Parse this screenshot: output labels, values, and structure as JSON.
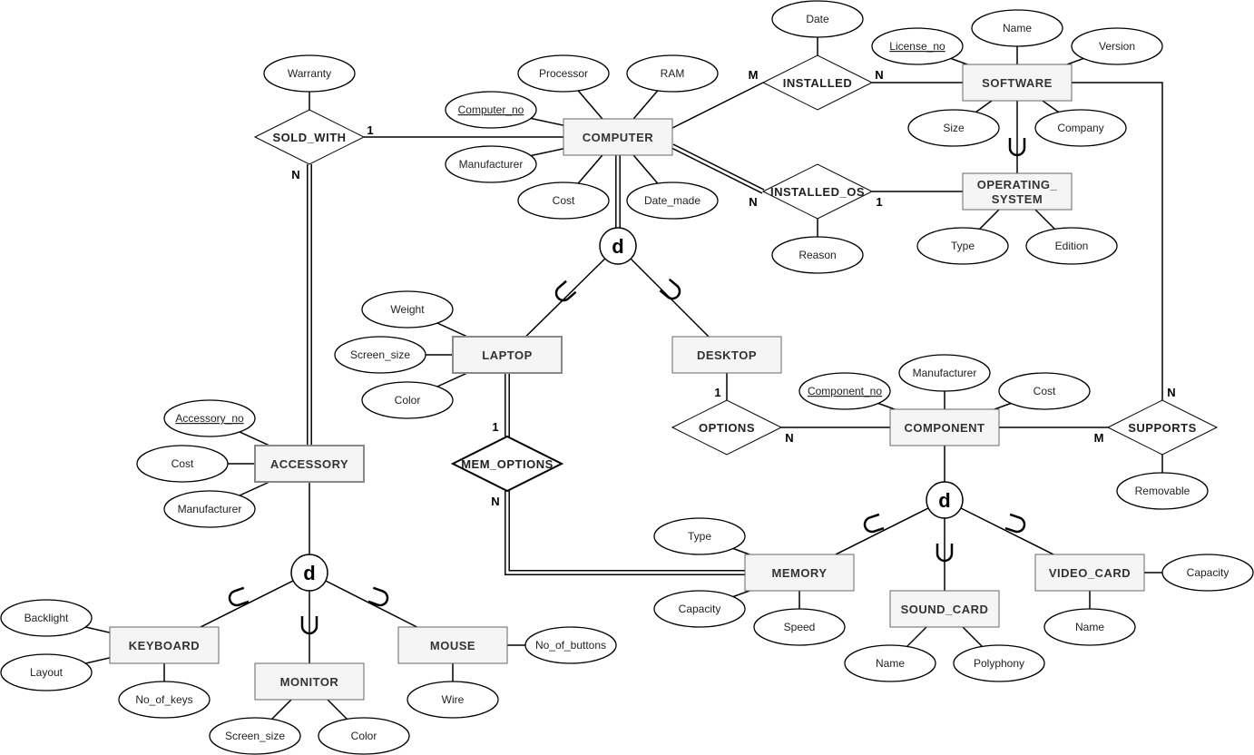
{
  "entities": [
    {
      "label": "COMPUTER"
    },
    {
      "label": "SOFTWARE"
    },
    {
      "label": "OPERATING_ SYSTEM"
    },
    {
      "label": "LAPTOP"
    },
    {
      "label": "DESKTOP"
    },
    {
      "label": "COMPONENT"
    },
    {
      "label": "ACCESSORY"
    },
    {
      "label": "MEMORY"
    },
    {
      "label": "SOUND_CARD"
    },
    {
      "label": "VIDEO_CARD"
    },
    {
      "label": "KEYBOARD"
    },
    {
      "label": "MONITOR"
    },
    {
      "label": "MOUSE"
    }
  ],
  "relationships": [
    {
      "label": "SOLD_WITH"
    },
    {
      "label": "INSTALLED"
    },
    {
      "label": "INSTALLED_OS"
    },
    {
      "label": "OPTIONS"
    },
    {
      "label": "MEM_OPTIONS"
    },
    {
      "label": "SUPPORTS"
    }
  ],
  "attributes": [
    {
      "label": "Warranty",
      "key": false
    },
    {
      "label": "Processor",
      "key": false
    },
    {
      "label": "RAM",
      "key": false
    },
    {
      "label": "Computer_no",
      "key": true
    },
    {
      "label": "Manufacturer",
      "key": false
    },
    {
      "label": "Cost",
      "key": false
    },
    {
      "label": "Date_made",
      "key": false
    },
    {
      "label": "Date",
      "key": false
    },
    {
      "label": "License_no",
      "key": true
    },
    {
      "label": "Name",
      "key": false
    },
    {
      "label": "Version",
      "key": false
    },
    {
      "label": "Size",
      "key": false
    },
    {
      "label": "Company",
      "key": false
    },
    {
      "label": "Type",
      "key": false
    },
    {
      "label": "Edition",
      "key": false
    },
    {
      "label": "Reason",
      "key": false
    },
    {
      "label": "Weight",
      "key": false
    },
    {
      "label": "Screen_size",
      "key": false
    },
    {
      "label": "Color",
      "key": false
    },
    {
      "label": "Accessory_no",
      "key": true
    },
    {
      "label": "Cost",
      "key": false
    },
    {
      "label": "Manufacturer",
      "key": false
    },
    {
      "label": "Manufacturer",
      "key": false
    },
    {
      "label": "Component_no",
      "key": true
    },
    {
      "label": "Cost",
      "key": false
    },
    {
      "label": "Removable",
      "key": false
    },
    {
      "label": "Type",
      "key": false
    },
    {
      "label": "Capacity",
      "key": false
    },
    {
      "label": "Speed",
      "key": false
    },
    {
      "label": "Name",
      "key": false
    },
    {
      "label": "Polyphony",
      "key": false
    },
    {
      "label": "Capacity",
      "key": false
    },
    {
      "label": "Name",
      "key": false
    },
    {
      "label": "Backlight",
      "key": false
    },
    {
      "label": "Layout",
      "key": false
    },
    {
      "label": "No_of_keys",
      "key": false
    },
    {
      "label": "Screen_size",
      "key": false
    },
    {
      "label": "Color",
      "key": false
    },
    {
      "label": "No_of_buttons",
      "key": false
    },
    {
      "label": "Wire",
      "key": false
    }
  ],
  "specializations": [
    {
      "label": "d",
      "superclass": "COMPUTER",
      "subclasses": [
        "LAPTOP",
        "DESKTOP"
      ]
    },
    {
      "label": "d",
      "superclass": "COMPONENT",
      "subclasses": [
        "MEMORY",
        "SOUND_CARD",
        "VIDEO_CARD"
      ]
    },
    {
      "label": "d",
      "superclass": "ACCESSORY",
      "subclasses": [
        "KEYBOARD",
        "MONITOR",
        "MOUSE"
      ]
    }
  ],
  "cardinalities": [
    "1",
    "N",
    "M",
    "N",
    "N",
    "1",
    "N",
    "M",
    "1",
    "N",
    "1",
    "N"
  ]
}
